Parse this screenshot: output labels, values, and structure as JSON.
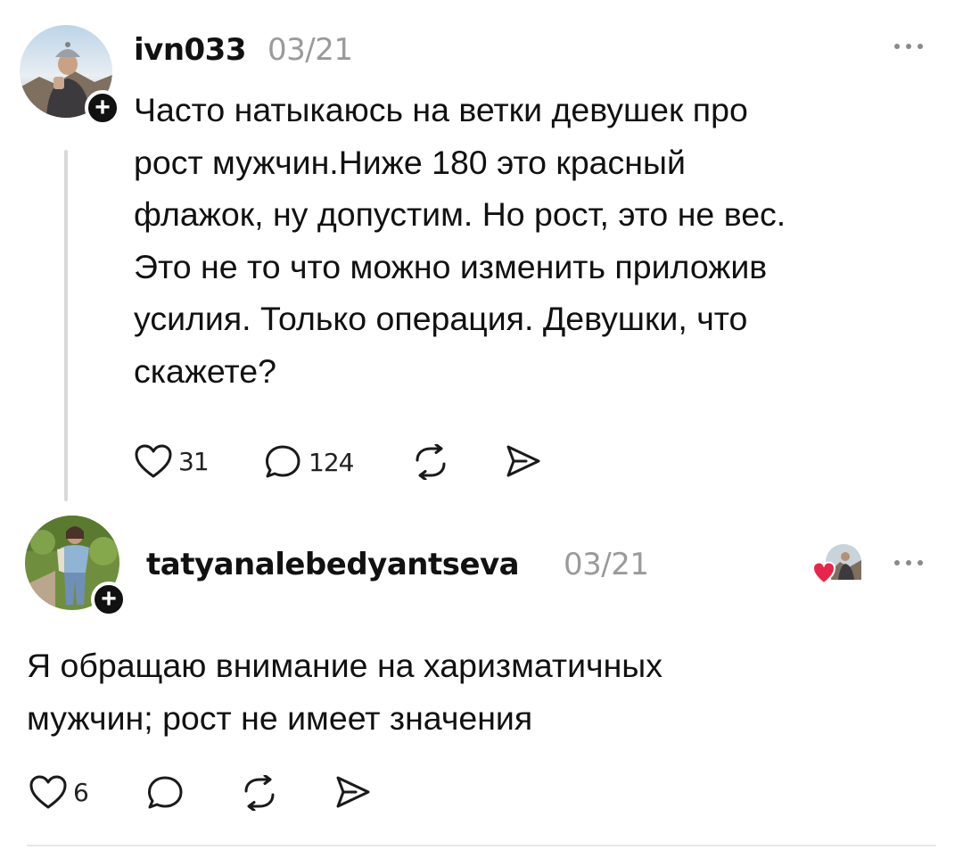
{
  "posts": [
    {
      "username": "ivn033",
      "date": "03/21",
      "text": "Часто натыкаюсь на ветки девушек про\nрост мужчин.Ниже 180 это красный\nфлажок, ну допустим. Но рост, это не вес.\nЭто не то что можно изменить приложив\nусилия. Только операция. Девушки, что\nскажете?",
      "likes": "31",
      "comments": "124",
      "icons": [
        "heart-icon",
        "comment-icon",
        "repost-icon",
        "share-icon",
        "more-icon",
        "follow-plus-icon"
      ]
    },
    {
      "username": "tatyanalebedyantseva",
      "date": "03/21",
      "text": "Я обращаю внимание на харизматичных\nмужчин; рост не имеет значения",
      "likes": "6",
      "comments": "",
      "icons": [
        "heart-icon",
        "comment-icon",
        "repost-icon",
        "share-icon",
        "more-icon",
        "follow-plus-icon",
        "liked-by-author-heart-icon"
      ]
    }
  ],
  "colors": {
    "text": "#111111",
    "muted": "#9a9a9a",
    "like_heart": "#e8254a",
    "divider": "#e6e6e6"
  }
}
